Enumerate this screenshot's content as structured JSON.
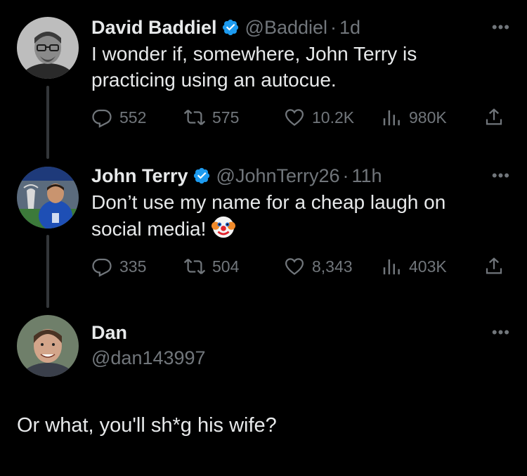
{
  "tweets": [
    {
      "name": "David Baddiel",
      "handle": "@Baddiel",
      "separator": "·",
      "time": "1d",
      "text": "I wonder if, somewhere, John Terry is practicing using an autocue.",
      "replies": "552",
      "retweets": "575",
      "likes": "10.2K",
      "views": "980K",
      "verified": true
    },
    {
      "name": "John Terry",
      "handle": "@JohnTerry26",
      "separator": "·",
      "time": "11h",
      "text": "Don’t use my name for a cheap laugh on social media!",
      "emoji": "clown-face",
      "replies": "335",
      "retweets": "504",
      "likes": "8,343",
      "views": "403K",
      "verified": true
    },
    {
      "name": "Dan",
      "handle": "@dan143997",
      "text": "Or what, you'll sh*g his wife?"
    }
  ],
  "icons": {
    "more": "more-horizontal-icon",
    "reply": "reply-icon",
    "retweet": "retweet-icon",
    "like": "heart-icon",
    "views": "views-icon",
    "share": "share-icon",
    "verified": "verified-badge-icon"
  },
  "colors": {
    "background": "#000000",
    "text": "#e7e9ea",
    "muted": "#71767b",
    "verified": "#1d9bf0",
    "thread_line": "#333639"
  }
}
